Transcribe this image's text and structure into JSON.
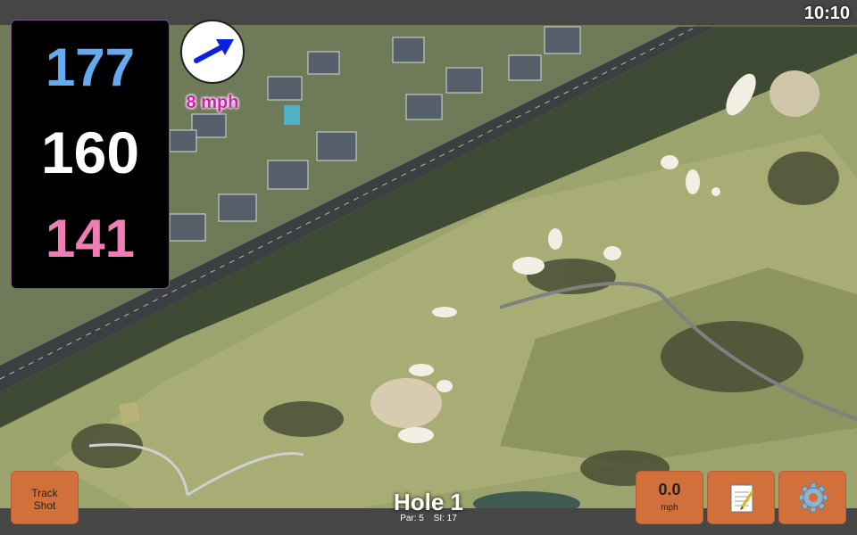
{
  "status_bar": {
    "time": "10:10"
  },
  "distances": {
    "back": "177",
    "middle": "160",
    "front": "141"
  },
  "wind": {
    "speed": "8 mph",
    "direction_icon": "wind-arrow-icon"
  },
  "hole": {
    "title": "Hole 1",
    "par": "Par: 5",
    "stroke_index": "SI: 17"
  },
  "buttons": {
    "track_shot_line1": "Track",
    "track_shot_line2": "Shot",
    "speed_value": "0.0",
    "speed_unit": "mph",
    "notes_icon": "notepad-icon",
    "settings_icon": "gear-icon"
  },
  "colors": {
    "back_distance": "#64aaf0",
    "middle_distance": "#ffffff",
    "front_distance": "#f07eb6",
    "wind_text": "#d21fb0",
    "button": "#d2703b"
  }
}
